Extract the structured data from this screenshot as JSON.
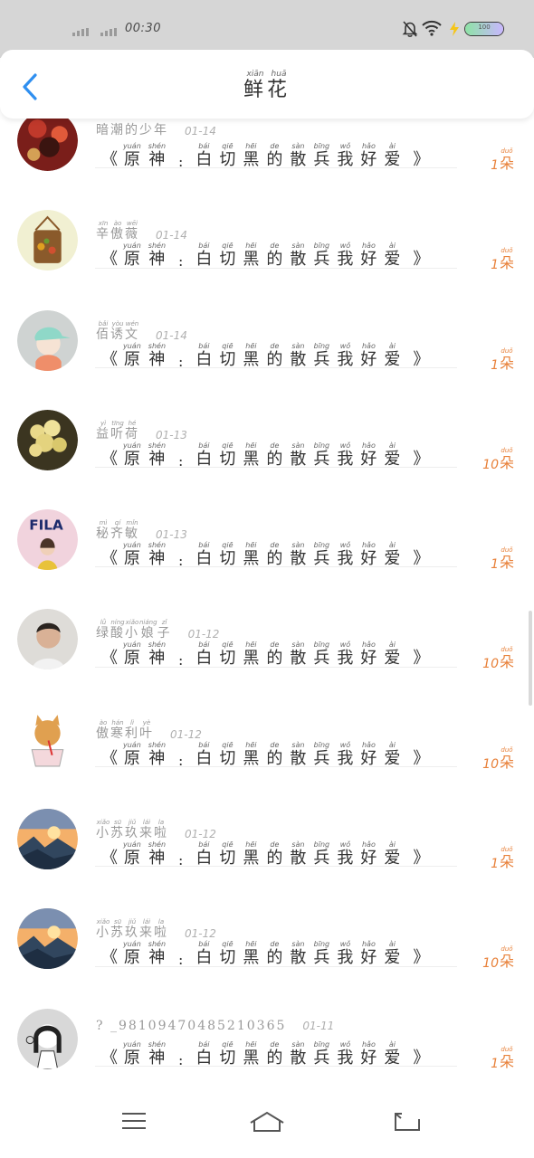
{
  "status_bar": {
    "time": "00:30",
    "battery_text": "100",
    "battery_level_percent": 100,
    "icons": [
      "signal-icon",
      "signal-icon",
      "notification-off-icon",
      "wifi-icon",
      "charging-icon",
      "battery-icon"
    ]
  },
  "header": {
    "title_chars": [
      {
        "char": "鲜",
        "pinyin": "xiān"
      },
      {
        "char": "花",
        "pinyin": "huā"
      }
    ],
    "back_icon": "chevron-left-icon",
    "accent_color": "#2f8ff0"
  },
  "content_template": {
    "open_bracket": "《",
    "close_bracket": "》",
    "colon": ":",
    "chars": [
      {
        "char": "原",
        "pinyin": "yuán"
      },
      {
        "char": "神",
        "pinyin": "shén"
      },
      {
        "char": ":",
        "pinyin": ""
      },
      {
        "char": "白",
        "pinyin": "bái"
      },
      {
        "char": "切",
        "pinyin": "qiē"
      },
      {
        "char": "黑",
        "pinyin": "hēi"
      },
      {
        "char": "的",
        "pinyin": "de"
      },
      {
        "char": "散",
        "pinyin": "sàn"
      },
      {
        "char": "兵",
        "pinyin": "bīng"
      },
      {
        "char": "我",
        "pinyin": "wǒ"
      },
      {
        "char": "好",
        "pinyin": "hǎo"
      },
      {
        "char": "爱",
        "pinyin": "ài"
      }
    ]
  },
  "count_unit": {
    "char": "朵",
    "pinyin": "duǒ"
  },
  "count_color": "#e8813a",
  "items": [
    {
      "avatar": "red-flower-portrait-avatar",
      "user": [
        {
          "c": "暗",
          "p": ""
        },
        {
          "c": "潮",
          "p": ""
        },
        {
          "c": "的",
          "p": ""
        },
        {
          "c": "少",
          "p": ""
        },
        {
          "c": "年",
          "p": ""
        }
      ],
      "date": "01-14",
      "count": "1"
    },
    {
      "avatar": "flower-bag-avatar",
      "user": [
        {
          "c": "辛",
          "p": "xīn"
        },
        {
          "c": "傲",
          "p": "ào"
        },
        {
          "c": "薇",
          "p": "wēi"
        }
      ],
      "date": "01-14",
      "count": "1"
    },
    {
      "avatar": "cartoon-girl-cap-avatar",
      "user": [
        {
          "c": "佰",
          "p": "bǎi"
        },
        {
          "c": "诱",
          "p": "yòu"
        },
        {
          "c": "文",
          "p": "wén"
        }
      ],
      "date": "01-14",
      "count": "1"
    },
    {
      "avatar": "yellow-flower-bouquet-avatar",
      "user": [
        {
          "c": "益",
          "p": "yì"
        },
        {
          "c": "听",
          "p": "tīng"
        },
        {
          "c": "荷",
          "p": "hé"
        }
      ],
      "date": "01-13",
      "count": "10"
    },
    {
      "avatar": "fila-girl-avatar",
      "user": [
        {
          "c": "秘",
          "p": "mì"
        },
        {
          "c": "齐",
          "p": "qí"
        },
        {
          "c": "敏",
          "p": "mǐn"
        }
      ],
      "date": "01-13",
      "count": "1"
    },
    {
      "avatar": "young-man-portrait-avatar",
      "user": [
        {
          "c": "绿",
          "p": "lǜ"
        },
        {
          "c": "酸",
          "p": "níng"
        },
        {
          "c": "小",
          "p": "xiǎo"
        },
        {
          "c": "娘",
          "p": "niáng"
        },
        {
          "c": "子",
          "p": "zǐ"
        }
      ],
      "date": "01-12",
      "count": "10"
    },
    {
      "avatar": "cat-drinking-avatar",
      "user": [
        {
          "c": "傲",
          "p": "ào"
        },
        {
          "c": "寒",
          "p": "hán"
        },
        {
          "c": "利",
          "p": "lì"
        },
        {
          "c": "叶",
          "p": "yè"
        }
      ],
      "date": "01-12",
      "count": "10"
    },
    {
      "avatar": "sunset-landscape-avatar",
      "user": [
        {
          "c": "小",
          "p": "xiǎo"
        },
        {
          "c": "苏",
          "p": "sū"
        },
        {
          "c": "玖",
          "p": "jiǔ"
        },
        {
          "c": "来",
          "p": "lái"
        },
        {
          "c": "啦",
          "p": "la"
        }
      ],
      "date": "01-12",
      "count": "1"
    },
    {
      "avatar": "sunset-landscape-avatar",
      "user": [
        {
          "c": "小",
          "p": "xiǎo"
        },
        {
          "c": "苏",
          "p": "sū"
        },
        {
          "c": "玖",
          "p": "jiǔ"
        },
        {
          "c": "来",
          "p": "lái"
        },
        {
          "c": "啦",
          "p": "la"
        }
      ],
      "date": "01-12",
      "count": "10"
    },
    {
      "avatar": "sketch-girl-avatar",
      "user": [
        {
          "c": "? _98109470485210365",
          "p": ""
        }
      ],
      "date": "01-11",
      "count": "1"
    }
  ],
  "navbar": {
    "icons": [
      "menu-icon",
      "home-icon",
      "back-icon"
    ]
  }
}
